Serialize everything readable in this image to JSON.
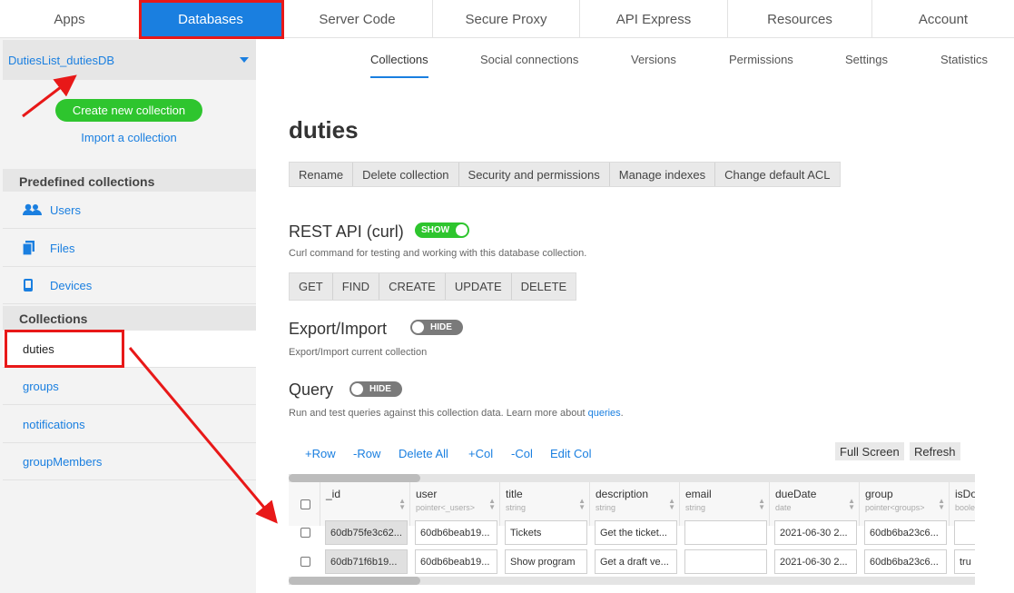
{
  "topnav": {
    "tabs": [
      {
        "label": "Apps"
      },
      {
        "label": "Databases"
      },
      {
        "label": "Server Code"
      },
      {
        "label": "Secure Proxy"
      },
      {
        "label": "API Express"
      },
      {
        "label": "Resources"
      },
      {
        "label": "Account"
      }
    ]
  },
  "sidebar": {
    "db_name": "DutiesList_dutiesDB",
    "create_label": "Create new collection",
    "import_label": "Import a collection",
    "predefined_header": "Predefined collections",
    "predefined": [
      {
        "label": "Users",
        "icon": "users-icon"
      },
      {
        "label": "Files",
        "icon": "files-icon"
      },
      {
        "label": "Devices",
        "icon": "device-icon"
      }
    ],
    "collections_header": "Collections",
    "collections": [
      {
        "label": "duties"
      },
      {
        "label": "groups"
      },
      {
        "label": "notifications"
      },
      {
        "label": "groupMembers"
      }
    ]
  },
  "subtabs": [
    {
      "label": "Collections"
    },
    {
      "label": "Social connections"
    },
    {
      "label": "Versions"
    },
    {
      "label": "Permissions"
    },
    {
      "label": "Settings"
    },
    {
      "label": "Statistics"
    }
  ],
  "collection": {
    "title": "duties",
    "actions": [
      "Rename",
      "Delete collection",
      "Security and permissions",
      "Manage indexes",
      "Change default ACL"
    ]
  },
  "rest": {
    "title": "REST API (curl)",
    "toggle": "SHOW",
    "desc": "Curl command for testing and working with this database collection.",
    "methods": [
      "GET",
      "FIND",
      "CREATE",
      "UPDATE",
      "DELETE"
    ]
  },
  "export": {
    "title": "Export/Import",
    "toggle": "HIDE",
    "desc": "Export/Import current collection"
  },
  "query": {
    "title": "Query",
    "toggle": "HIDE",
    "desc_before": "Run and test queries against this collection data. Learn more about ",
    "desc_link": "queries",
    "desc_after": "."
  },
  "table_actions": {
    "add_row": "+Row",
    "remove_row": "-Row",
    "delete_all": "Delete All",
    "add_col": "+Col",
    "remove_col": "-Col",
    "edit_col": "Edit Col",
    "full_screen": "Full Screen",
    "refresh": "Refresh"
  },
  "grid": {
    "columns": [
      {
        "name": "_id",
        "type": ""
      },
      {
        "name": "user",
        "type": "pointer<_users>"
      },
      {
        "name": "title",
        "type": "string"
      },
      {
        "name": "description",
        "type": "string"
      },
      {
        "name": "email",
        "type": "string"
      },
      {
        "name": "dueDate",
        "type": "date"
      },
      {
        "name": "group",
        "type": "pointer<groups>"
      },
      {
        "name": "isDo",
        "type": "boole"
      }
    ],
    "rows": [
      {
        "id": "60db75fe3c62...",
        "user": "60db6beab19...",
        "title": "Tickets",
        "description": "Get the ticket...",
        "email": "",
        "dueDate": "2021-06-30 2...",
        "group": "60db6ba23c6...",
        "isDo": ""
      },
      {
        "id": "60db71f6b19...",
        "user": "60db6beab19...",
        "title": "Show program",
        "description": "Get a draft ve...",
        "email": "",
        "dueDate": "2021-06-30 2...",
        "group": "60db6ba23c6...",
        "isDo": "tru"
      }
    ]
  },
  "colors": {
    "accent": "#1a7fe0",
    "success": "#2ec52e",
    "annotation": "#e81818"
  }
}
